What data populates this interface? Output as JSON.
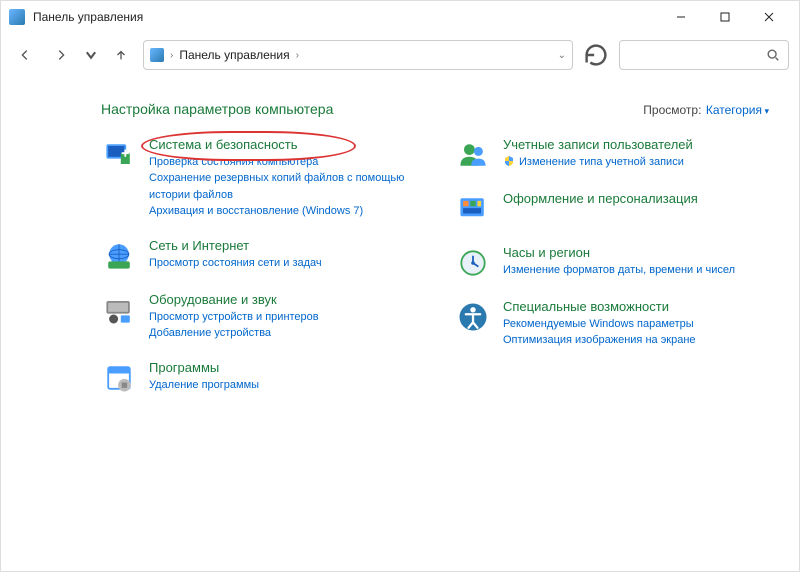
{
  "title": "Панель управления",
  "breadcrumb": {
    "root": "Панель управления"
  },
  "page_title": "Настройка параметров компьютера",
  "view": {
    "label": "Просмотр:",
    "value": "Категория"
  },
  "left": [
    {
      "title": "Система и безопасность",
      "links": [
        "Проверка состояния компьютера",
        "Сохранение резервных копий файлов с помощью истории файлов",
        "Архивация и восстановление (Windows 7)"
      ],
      "highlight": true,
      "icon": "system"
    },
    {
      "title": "Сеть и Интернет",
      "links": [
        "Просмотр состояния сети и задач"
      ],
      "icon": "network"
    },
    {
      "title": "Оборудование и звук",
      "links": [
        "Просмотр устройств и принтеров",
        "Добавление устройства"
      ],
      "icon": "hardware"
    },
    {
      "title": "Программы",
      "links": [
        "Удаление программы"
      ],
      "icon": "programs"
    }
  ],
  "right": [
    {
      "title": "Учетные записи пользователей",
      "links": [
        "Изменение типа учетной записи"
      ],
      "shield": [
        true
      ],
      "icon": "users"
    },
    {
      "title": "Оформление и персонализация",
      "links": [],
      "icon": "appearance"
    },
    {
      "title": "Часы и регион",
      "links": [
        "Изменение форматов даты, времени и чисел"
      ],
      "icon": "clock"
    },
    {
      "title": "Специальные возможности",
      "links": [
        "Рекомендуемые Windows параметры",
        "Оптимизация изображения на экране"
      ],
      "icon": "access"
    }
  ]
}
